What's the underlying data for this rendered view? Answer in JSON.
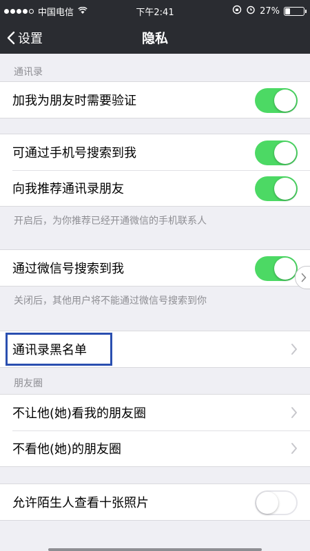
{
  "status_bar": {
    "carrier": "中国电信",
    "time": "下午2:41",
    "battery_percent": "27%",
    "battery_level": 0.27
  },
  "nav": {
    "back_label": "设置",
    "title": "隐私"
  },
  "sections": {
    "contacts_label": "通讯录",
    "add_me_verify": "加我为朋友时需要验证",
    "find_by_phone": "可通过手机号搜索到我",
    "recommend_contacts": "向我推荐通讯录朋友",
    "recommend_note": "开启后，为你推荐已经开通微信的手机联系人",
    "find_by_wechat_id": "通过微信号搜索到我",
    "wechat_id_note": "关闭后，其他用户将不能通过微信号搜索到你",
    "blacklist": "通讯录黑名单",
    "moments_label": "朋友圈",
    "hide_my_moments": "不让他(她)看我的朋友圈",
    "hide_their_moments": "不看他(她)的朋友圈",
    "stranger_photos": "允许陌生人查看十张照片"
  },
  "toggles": {
    "add_me_verify": true,
    "find_by_phone": true,
    "recommend_contacts": true,
    "find_by_wechat_id": true,
    "stranger_photos": false
  },
  "colors": {
    "toggle_on": "#4cd964",
    "nav_bg": "#2a2c31",
    "highlight_box": "#2a4fb0"
  }
}
